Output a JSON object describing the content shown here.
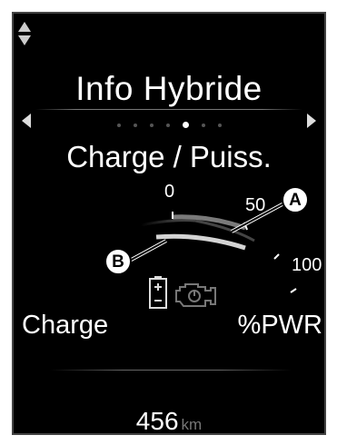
{
  "header": {
    "title": "Info Hybride"
  },
  "pager": {
    "total": 7,
    "active_index": 4
  },
  "screen": {
    "subtitle": "Charge / Puiss."
  },
  "gauge": {
    "tick_labels": {
      "zero": "0",
      "fifty": "50",
      "hundred": "100"
    }
  },
  "labels": {
    "left": "Charge",
    "right": "%PWR"
  },
  "odometer": {
    "value": "456",
    "unit": "km"
  },
  "callouts": {
    "a": "A",
    "b": "B"
  },
  "icons": [
    "up-down-arrow-icon",
    "left-arrow-icon",
    "right-arrow-icon",
    "battery-icon",
    "engine-icon"
  ]
}
